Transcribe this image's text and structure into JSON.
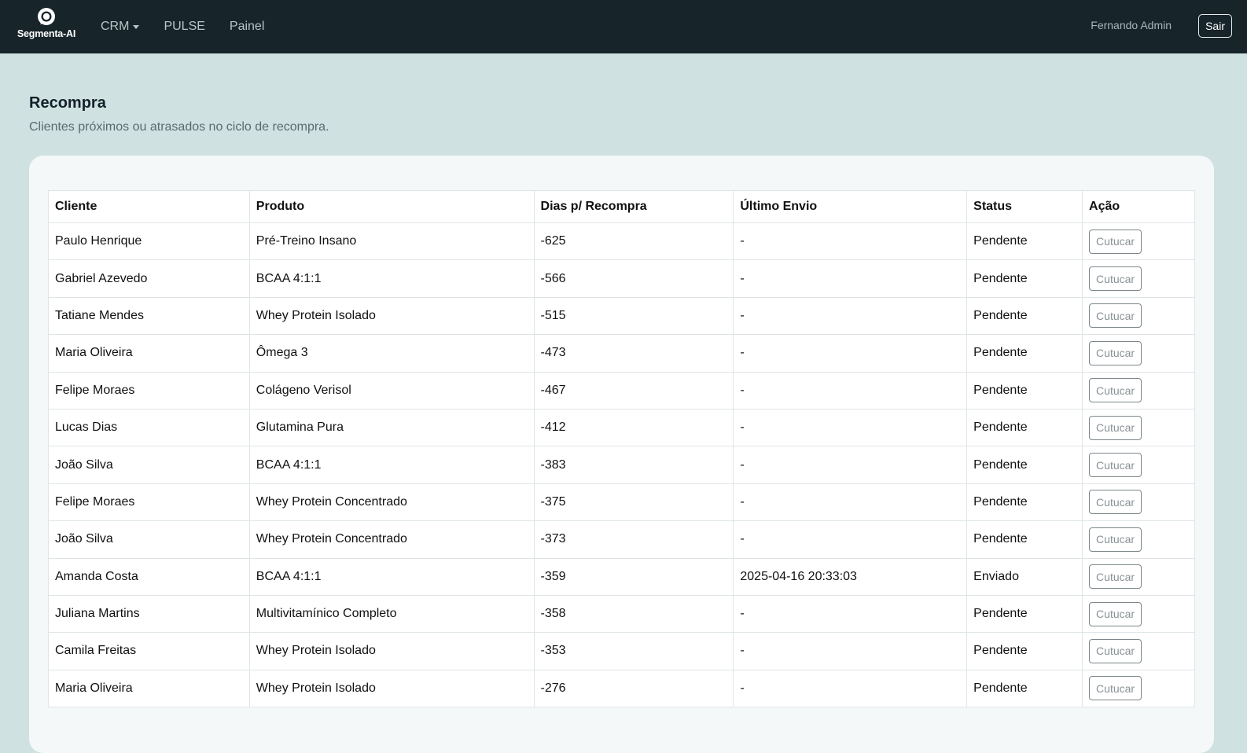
{
  "navbar": {
    "brand": "Segmenta-AI",
    "items": [
      {
        "label": "CRM",
        "dropdown": true
      },
      {
        "label": "PULSE"
      },
      {
        "label": "Painel"
      }
    ],
    "user_name": "Fernando Admin",
    "logout_label": "Sair"
  },
  "page": {
    "title": "Recompra",
    "subtitle": "Clientes próximos ou atrasados no ciclo de recompra."
  },
  "table": {
    "headers": [
      "Cliente",
      "Produto",
      "Dias p/ Recompra",
      "Último Envio",
      "Status",
      "Ação"
    ],
    "action_label": "Cutucar",
    "rows": [
      {
        "cliente": "Paulo Henrique",
        "produto": "Pré-Treino Insano",
        "dias": "-625",
        "envio": "-",
        "status": "Pendente"
      },
      {
        "cliente": "Gabriel Azevedo",
        "produto": "BCAA 4:1:1",
        "dias": "-566",
        "envio": "-",
        "status": "Pendente"
      },
      {
        "cliente": "Tatiane Mendes",
        "produto": "Whey Protein Isolado",
        "dias": "-515",
        "envio": "-",
        "status": "Pendente"
      },
      {
        "cliente": "Maria Oliveira",
        "produto": "Ômega 3",
        "dias": "-473",
        "envio": "-",
        "status": "Pendente"
      },
      {
        "cliente": "Felipe Moraes",
        "produto": "Colágeno Verisol",
        "dias": "-467",
        "envio": "-",
        "status": "Pendente"
      },
      {
        "cliente": "Lucas Dias",
        "produto": "Glutamina Pura",
        "dias": "-412",
        "envio": "-",
        "status": "Pendente"
      },
      {
        "cliente": "João Silva",
        "produto": "BCAA 4:1:1",
        "dias": "-383",
        "envio": "-",
        "status": "Pendente"
      },
      {
        "cliente": "Felipe Moraes",
        "produto": "Whey Protein Concentrado",
        "dias": "-375",
        "envio": "-",
        "status": "Pendente"
      },
      {
        "cliente": "João Silva",
        "produto": "Whey Protein Concentrado",
        "dias": "-373",
        "envio": "-",
        "status": "Pendente"
      },
      {
        "cliente": "Amanda Costa",
        "produto": "BCAA 4:1:1",
        "dias": "-359",
        "envio": "2025-04-16 20:33:03",
        "status": "Enviado"
      },
      {
        "cliente": "Juliana Martins",
        "produto": "Multivitamínico Completo",
        "dias": "-358",
        "envio": "-",
        "status": "Pendente"
      },
      {
        "cliente": "Camila Freitas",
        "produto": "Whey Protein Isolado",
        "dias": "-353",
        "envio": "-",
        "status": "Pendente"
      },
      {
        "cliente": "Maria Oliveira",
        "produto": "Whey Protein Isolado",
        "dias": "-276",
        "envio": "-",
        "status": "Pendente"
      }
    ]
  }
}
